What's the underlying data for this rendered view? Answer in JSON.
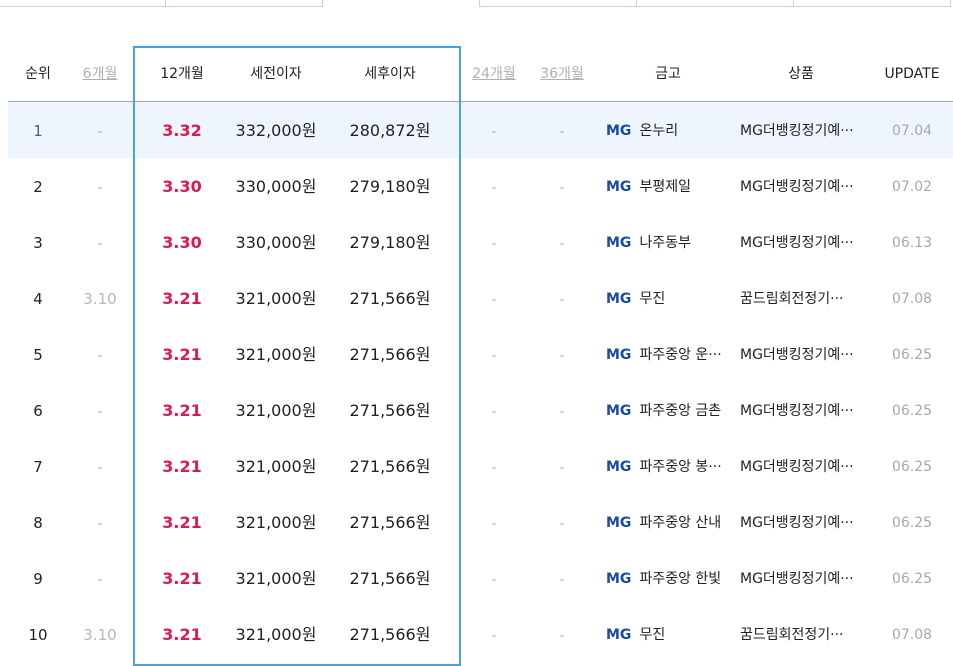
{
  "header": {
    "rank": "순위",
    "m6": "6개월",
    "m12": "12개월",
    "pre_tax": "세전이자",
    "post_tax": "세후이자",
    "m24": "24개월",
    "m36": "36개월",
    "bank": "금고",
    "product": "상품",
    "update": "UPDATE"
  },
  "rows": [
    {
      "rank": "1",
      "m6": "-",
      "m12": "3.32",
      "pre": "332,000원",
      "post": "280,872원",
      "m24": "-",
      "m36": "-",
      "mg": "MG",
      "bank": "온누리",
      "product": "MG더뱅킹정기예···",
      "update": "07.04"
    },
    {
      "rank": "2",
      "m6": "-",
      "m12": "3.30",
      "pre": "330,000원",
      "post": "279,180원",
      "m24": "-",
      "m36": "-",
      "mg": "MG",
      "bank": "부평제일",
      "product": "MG더뱅킹정기예···",
      "update": "07.02"
    },
    {
      "rank": "3",
      "m6": "-",
      "m12": "3.30",
      "pre": "330,000원",
      "post": "279,180원",
      "m24": "-",
      "m36": "-",
      "mg": "MG",
      "bank": "나주동부",
      "product": "MG더뱅킹정기예···",
      "update": "06.13"
    },
    {
      "rank": "4",
      "m6": "3.10",
      "m12": "3.21",
      "pre": "321,000원",
      "post": "271,566원",
      "m24": "-",
      "m36": "-",
      "mg": "MG",
      "bank": "무진",
      "product": "꿈드림회전정기···",
      "update": "07.08"
    },
    {
      "rank": "5",
      "m6": "-",
      "m12": "3.21",
      "pre": "321,000원",
      "post": "271,566원",
      "m24": "-",
      "m36": "-",
      "mg": "MG",
      "bank": "파주중앙 운···",
      "product": "MG더뱅킹정기예···",
      "update": "06.25"
    },
    {
      "rank": "6",
      "m6": "-",
      "m12": "3.21",
      "pre": "321,000원",
      "post": "271,566원",
      "m24": "-",
      "m36": "-",
      "mg": "MG",
      "bank": "파주중앙 금촌",
      "product": "MG더뱅킹정기예···",
      "update": "06.25"
    },
    {
      "rank": "7",
      "m6": "-",
      "m12": "3.21",
      "pre": "321,000원",
      "post": "271,566원",
      "m24": "-",
      "m36": "-",
      "mg": "MG",
      "bank": "파주중앙 봉···",
      "product": "MG더뱅킹정기예···",
      "update": "06.25"
    },
    {
      "rank": "8",
      "m6": "-",
      "m12": "3.21",
      "pre": "321,000원",
      "post": "271,566원",
      "m24": "-",
      "m36": "-",
      "mg": "MG",
      "bank": "파주중앙 산내",
      "product": "MG더뱅킹정기예···",
      "update": "06.25"
    },
    {
      "rank": "9",
      "m6": "-",
      "m12": "3.21",
      "pre": "321,000원",
      "post": "271,566원",
      "m24": "-",
      "m36": "-",
      "mg": "MG",
      "bank": "파주중앙 한빛",
      "product": "MG더뱅킹정기예···",
      "update": "06.25"
    },
    {
      "rank": "10",
      "m6": "3.10",
      "m12": "3.21",
      "pre": "321,000원",
      "post": "271,566원",
      "m24": "-",
      "m36": "-",
      "mg": "MG",
      "bank": "무진",
      "product": "꿈드림회전정기···",
      "update": "07.08"
    }
  ]
}
